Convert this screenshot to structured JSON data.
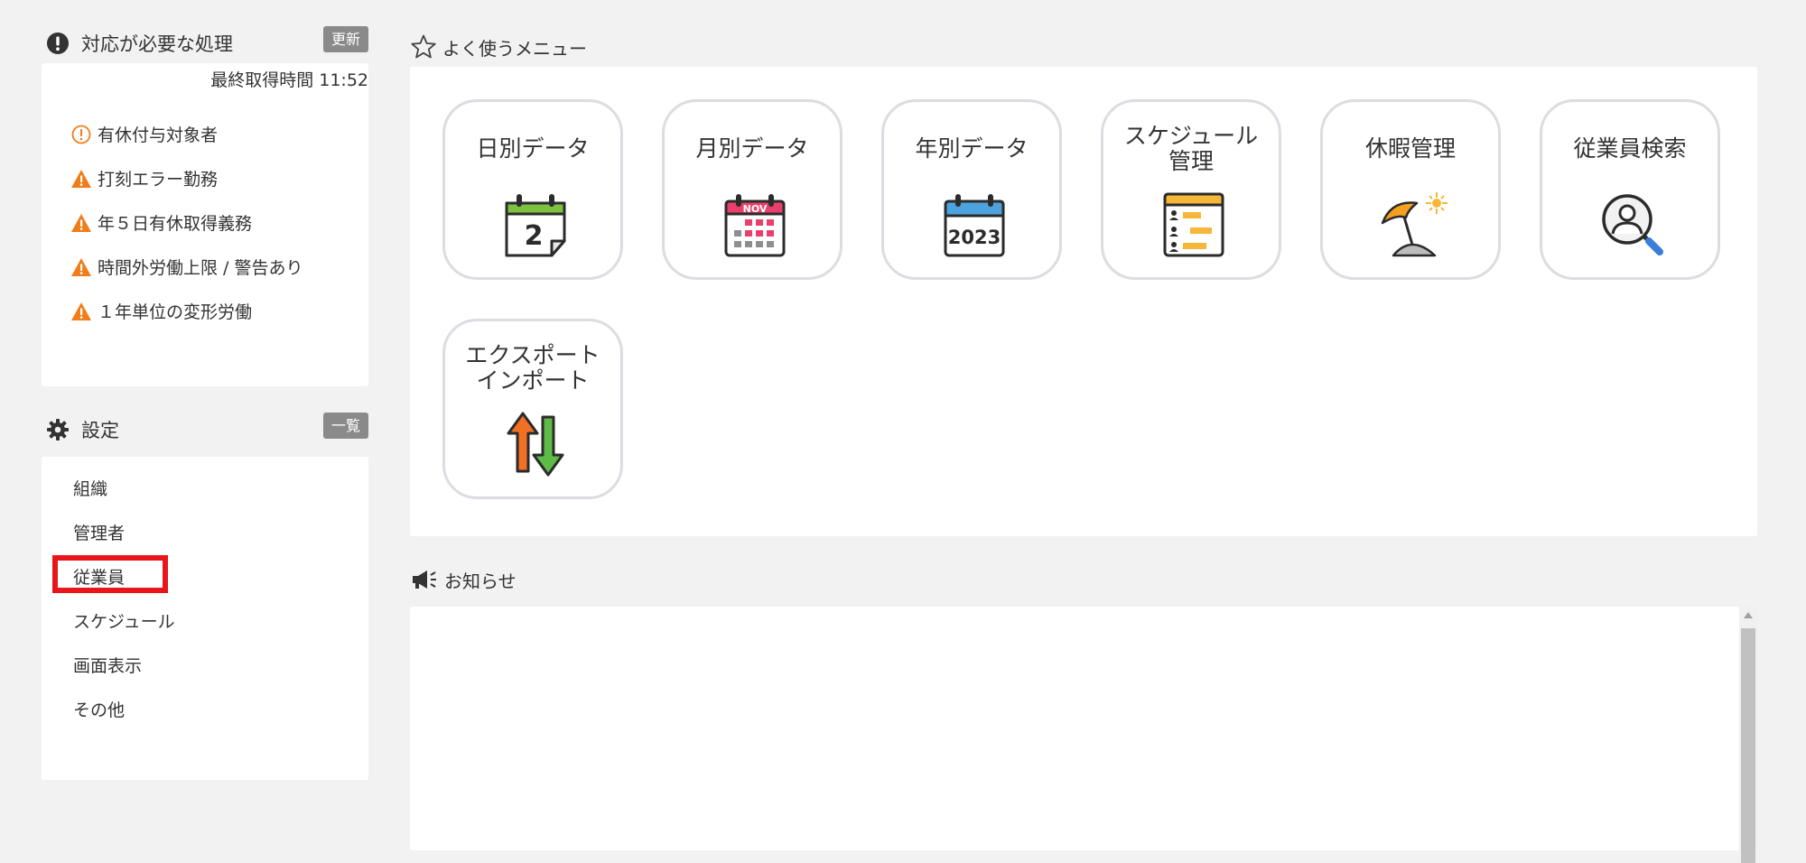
{
  "pending": {
    "title": "対応が必要な処理",
    "refresh_label": "更新",
    "last_fetch": "最終取得時間 11:52",
    "items": [
      {
        "label": "有休付与対象者",
        "icon": "info-circle-icon"
      },
      {
        "label": "打刻エラー勤務",
        "icon": "warning-triangle-icon"
      },
      {
        "label": "年５日有休取得義務",
        "icon": "warning-triangle-icon"
      },
      {
        "label": "時間外労働上限 / 警告あり",
        "icon": "warning-triangle-icon"
      },
      {
        "label": "１年単位の変形労働",
        "icon": "warning-triangle-icon"
      }
    ]
  },
  "settings": {
    "title": "設定",
    "list_label": "一覧",
    "items": [
      "組織",
      "管理者",
      "従業員",
      "スケジュール",
      "画面表示",
      "その他"
    ]
  },
  "favorites": {
    "title": "よく使うメニュー",
    "tiles": [
      {
        "label": "日別データ",
        "icon": "calendar-day-icon",
        "icon_text": "2"
      },
      {
        "label": "月別データ",
        "icon": "calendar-month-icon",
        "icon_text": "NOV"
      },
      {
        "label": "年別データ",
        "icon": "calendar-year-icon",
        "icon_text": "2023"
      },
      {
        "label": "スケジュール\n管理",
        "icon": "schedule-chart-icon"
      },
      {
        "label": "休暇管理",
        "icon": "beach-umbrella-icon"
      },
      {
        "label": "従業員検索",
        "icon": "user-search-icon"
      },
      {
        "label": "エクスポート\nインポート",
        "icon": "export-import-arrows-icon"
      }
    ]
  },
  "news": {
    "title": "お知らせ"
  },
  "colors": {
    "warning": "#f07d1a",
    "highlight": "#e8161b",
    "header_button": "#8a8a8a"
  }
}
